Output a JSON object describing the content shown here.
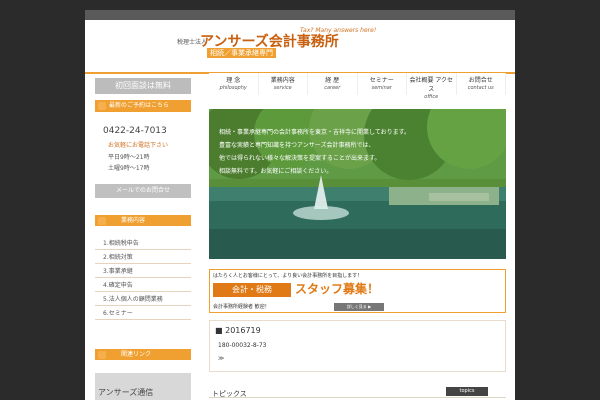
{
  "header": {
    "logo_prefix": "税理士法人",
    "logo_title": "アンサーズ会計事務所",
    "logo_subtitle": "相続／事業承継専門",
    "logo_tagline": "Tax? Many answers here!"
  },
  "sidebar": {
    "badge": "初回面談は無料",
    "contact_heading": "最新のご予約はこちら",
    "phone": "0422-24-7013",
    "contact_notes": [
      "お気軽にお電話下さい",
      "平日9時～21時",
      "土曜9時～17時"
    ],
    "mail_button": "メールでのお問合せ",
    "biz_heading": "業務内容",
    "biz_items": [
      "1.相続税申告",
      "2.相続対策",
      "3.事業承継",
      "4.確定申告",
      "5.法人個人の顧問業務",
      "6.セミナー"
    ],
    "links_heading": "関連リンク",
    "bottom_banner": "アンサーズ通信"
  },
  "nav": {
    "items": [
      {
        "jp": "理 念",
        "en": "philosophy"
      },
      {
        "jp": "業務内容",
        "en": "service"
      },
      {
        "jp": "経 歴",
        "en": "career"
      },
      {
        "jp": "セミナー",
        "en": "seminar"
      },
      {
        "jp": "会社概要\nアクセス",
        "en": "office"
      },
      {
        "jp": "お問合せ",
        "en": "contact us"
      }
    ]
  },
  "hero": {
    "lines": [
      "相続・事業承継専門の会計事務所を東京・吉祥寺に開業しております。",
      "豊富な実績と専門知識を持つアンサーズ会計事務所では、",
      "他では得られない様々な解決策を提案することが出来ます。",
      "相談無料です。お気軽にご相談ください。"
    ]
  },
  "recruit": {
    "top": "はたらく人とお客様にとって、より良い会計事務所を目指します！",
    "label": "会計・税務",
    "main": "スタッフ募集！",
    "foot": "会計事務所経験者 歓迎！",
    "button": "詳しく見る ▶"
  },
  "news": {
    "title": "2016719",
    "item": "180-00032-8-73",
    "arrow": "≫"
  },
  "topics": {
    "title": "トピックス",
    "pill": "topics"
  }
}
